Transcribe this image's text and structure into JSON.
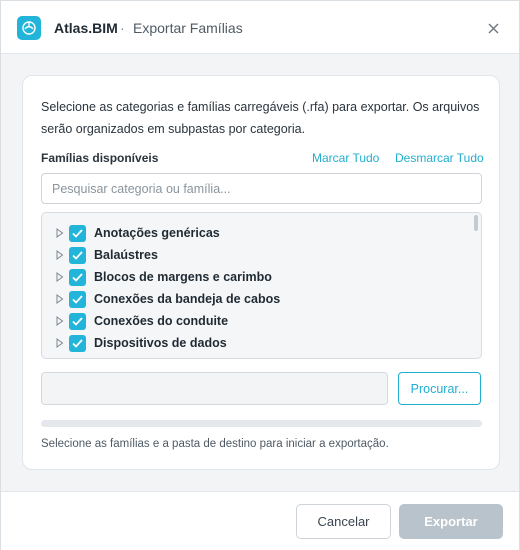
{
  "titlebar": {
    "app_name": "Atlas.BIM",
    "separator": "·",
    "dialog_title": "Exportar Famílias",
    "close_label": "×"
  },
  "intro_text": "Selecione as categorias e famílias carregáveis (.rfa) para exportar. Os arquivos serão organizados em subpastas por categoria.",
  "families": {
    "label": "Famílias disponíveis",
    "select_all": "Marcar Tudo",
    "deselect_all": "Desmarcar Tudo",
    "search_placeholder": "Pesquisar categoria ou família...",
    "search_value": "",
    "items": [
      {
        "label": "Anotações genéricas",
        "checked": true
      },
      {
        "label": "Balaústres",
        "checked": true
      },
      {
        "label": "Blocos de margens e carimbo",
        "checked": true
      },
      {
        "label": "Conexões da bandeja de cabos",
        "checked": true
      },
      {
        "label": "Conexões do conduite",
        "checked": true
      },
      {
        "label": "Dispositivos de dados",
        "checked": true
      }
    ]
  },
  "destination": {
    "path_value": "",
    "browse_label": "Procurar..."
  },
  "progress": {
    "fraction": 0
  },
  "status_text": "Selecione as famílias e a pasta de destino para iniciar a exportação.",
  "footer": {
    "cancel_label": "Cancelar",
    "export_label": "Exportar"
  },
  "colors": {
    "accent": "#22b5d9",
    "link": "#22aecf",
    "disabled_button": "#b9c3cb"
  }
}
